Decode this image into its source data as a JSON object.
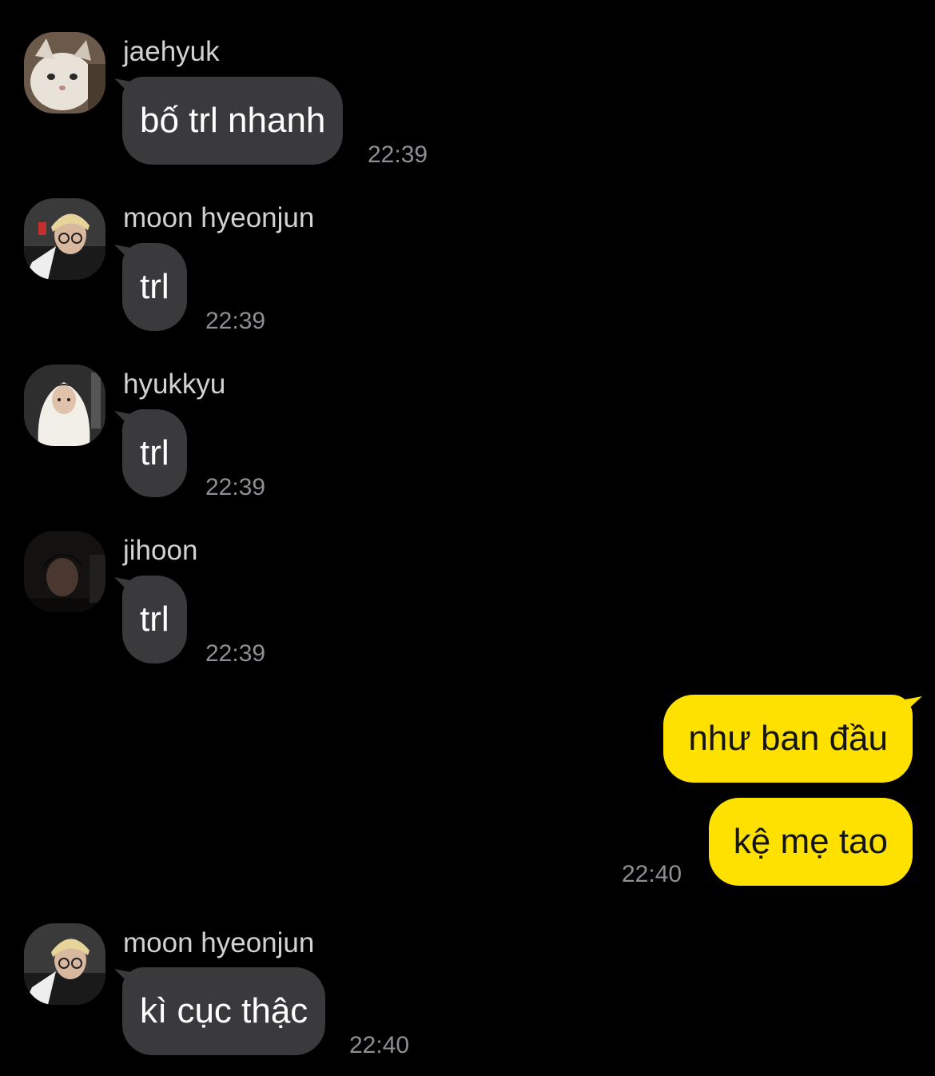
{
  "colors": {
    "background": "#000000",
    "incoming_bubble": "#3a3a3c",
    "outgoing_bubble": "#ffe100",
    "timestamp": "#8e8e93",
    "sender_name": "#d2d2d2"
  },
  "messages": [
    {
      "sender": "jaehyuk",
      "avatar": "cat-avatar-icon",
      "text": "bố trl nhanh",
      "time": "22:39"
    },
    {
      "sender": "moon hyeonjun",
      "avatar": "person-avatar-icon",
      "text": "trl",
      "time": "22:39"
    },
    {
      "sender": "hyukkyu",
      "avatar": "person-avatar-icon",
      "text": "trl",
      "time": "22:39"
    },
    {
      "sender": "jihoon",
      "avatar": "person-avatar-icon",
      "text": "trl",
      "time": "22:39"
    },
    {
      "outgoing": true,
      "text": "như ban đầu"
    },
    {
      "outgoing": true,
      "text": "kệ mẹ tao",
      "time": "22:40"
    },
    {
      "sender": "moon hyeonjun",
      "avatar": "person-avatar-icon",
      "text": "kì cục thậc",
      "time": "22:40"
    }
  ]
}
